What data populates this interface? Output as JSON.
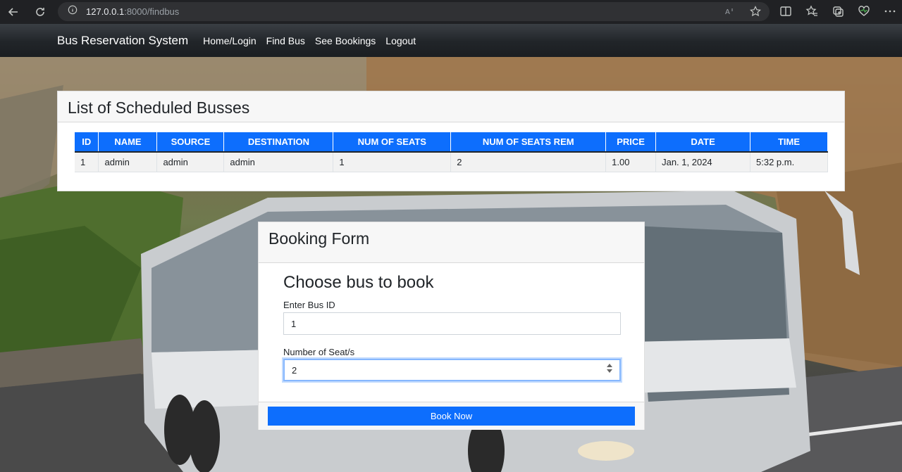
{
  "browser": {
    "url_host": "127.0.0.1",
    "url_path": ":8000/findbus",
    "addr_right_icons": [
      "read-aloud-icon",
      "favorite-star-icon"
    ],
    "toolbar_icons": [
      "split-screen-icon",
      "favorites-icon",
      "collections-icon",
      "browser-essentials-icon",
      "more-icon"
    ]
  },
  "navbar": {
    "brand": "Bus Reservation System",
    "links": [
      "Home/Login",
      "Find Bus",
      "See Bookings",
      "Logout"
    ]
  },
  "list": {
    "title": "List of Scheduled Busses",
    "columns": [
      "ID",
      "NAME",
      "SOURCE",
      "DESTINATION",
      "NUM OF SEATS",
      "NUM OF SEATS REM",
      "PRICE",
      "DATE",
      "TIME"
    ],
    "rows": [
      [
        "1",
        "admin",
        "admin",
        "admin",
        "1",
        "2",
        "1.00",
        "Jan. 1, 2024",
        "5:32 p.m."
      ]
    ]
  },
  "booking": {
    "header": "Booking Form",
    "heading": "Choose bus to book",
    "bus_id_label": "Enter Bus ID",
    "bus_id_value": "1",
    "seats_label": "Number of Seat/s",
    "seats_value": "2",
    "submit_label": "Book Now"
  },
  "colors": {
    "primary": "#0d6efd",
    "navbar": "#212529",
    "browser_bar": "#202124"
  }
}
